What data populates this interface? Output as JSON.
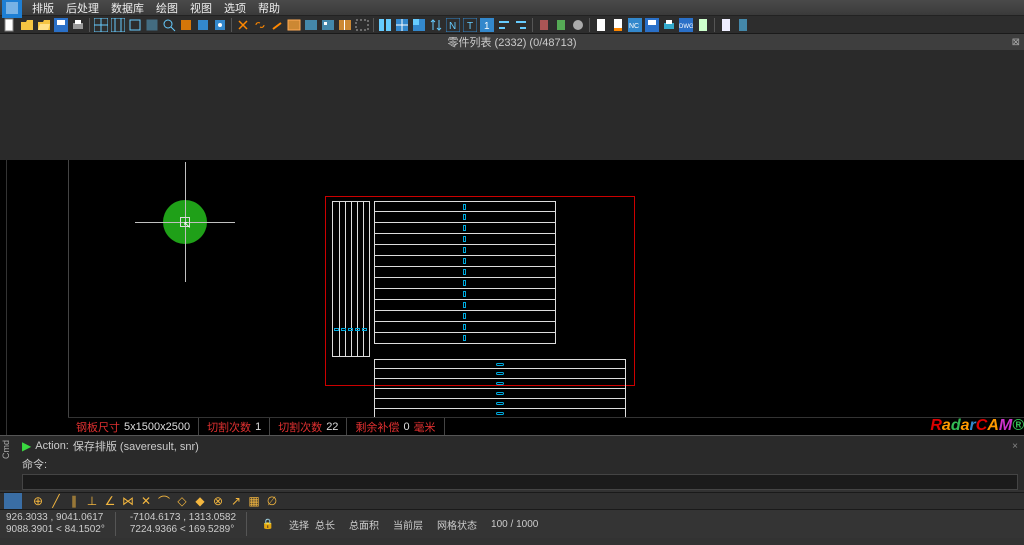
{
  "menu": {
    "items": [
      "排版",
      "后处理",
      "数据库",
      "绘图",
      "视图",
      "选项",
      "帮助"
    ]
  },
  "partsbar": {
    "title": "零件列表 (2332) (0/48713)",
    "close": "⊠"
  },
  "infobar": {
    "sheet_label": "钢板尺寸",
    "sheet_value": "5x1500x2500",
    "cuts_label": "切割次数",
    "cuts_value": "1",
    "pierce_label": "切割次数",
    "pierce_value": "22",
    "remain_label": "剩余补偿",
    "remain_value": "0",
    "unit": "毫米",
    "logo": "RadarCAM®"
  },
  "cmd": {
    "panel_label": "Cmd",
    "action_label": "Action:",
    "action_text": "保存排版 (saveresult, snr)",
    "prompt_label": "命令:"
  },
  "status": {
    "coord1a": "926.3033 , 9041.0617",
    "coord1b": "9088.3901 < 84.1502°",
    "coord2a": "-7104.6173 , 1313.0582",
    "coord2b": "7224.9366 < 169.5289°",
    "sel_label": "选择",
    "len_label": "总长",
    "area_label": "总面积",
    "layer_label": "当前层",
    "grid_label": "网格状态",
    "grid_value": "100 / 1000"
  },
  "chart_data": {
    "type": "table",
    "title": "Nesting sheet parameters",
    "series": [
      {
        "name": "钢板尺寸",
        "values": [
          "5x1500x2500"
        ]
      },
      {
        "name": "切割次数",
        "values": [
          1
        ]
      },
      {
        "name": "切割次数",
        "values": [
          22
        ]
      },
      {
        "name": "剩余补偿",
        "values": [
          0
        ]
      }
    ],
    "unit": "毫米"
  }
}
